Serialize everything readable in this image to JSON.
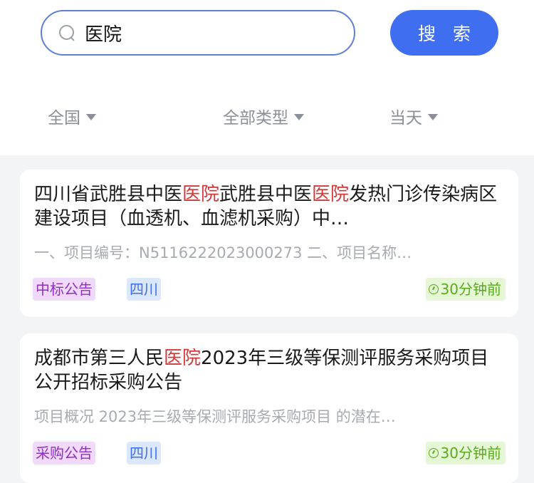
{
  "search": {
    "value": "医院",
    "button_label": "搜 索"
  },
  "filters": {
    "region": "全国",
    "type": "全部类型",
    "time": "当天"
  },
  "results": [
    {
      "title_parts": [
        "四川省武胜县中医",
        "医院",
        "武胜县中医",
        "医院",
        "发热门诊传染病区建设项目（血透机、血滤机采购）中…"
      ],
      "desc": "一、项目编号：N5116222023000273 二、项目名称…",
      "type_tag": "中标公告",
      "region_tag": "四川",
      "time": "30分钟前"
    },
    {
      "title_parts": [
        "成都市第三人民",
        "医院",
        "2023年三级等保测评服务采购项目公开招标采购公告"
      ],
      "desc": "项目概况 2023年三级等保测评服务采购项目 的潜在…",
      "type_tag": "采购公告",
      "region_tag": "四川",
      "time": "30分钟前"
    }
  ],
  "colors": {
    "accent": "#3f6ef0",
    "highlight": "#d23a3a",
    "time_badge_text": "#5aaa1e"
  }
}
